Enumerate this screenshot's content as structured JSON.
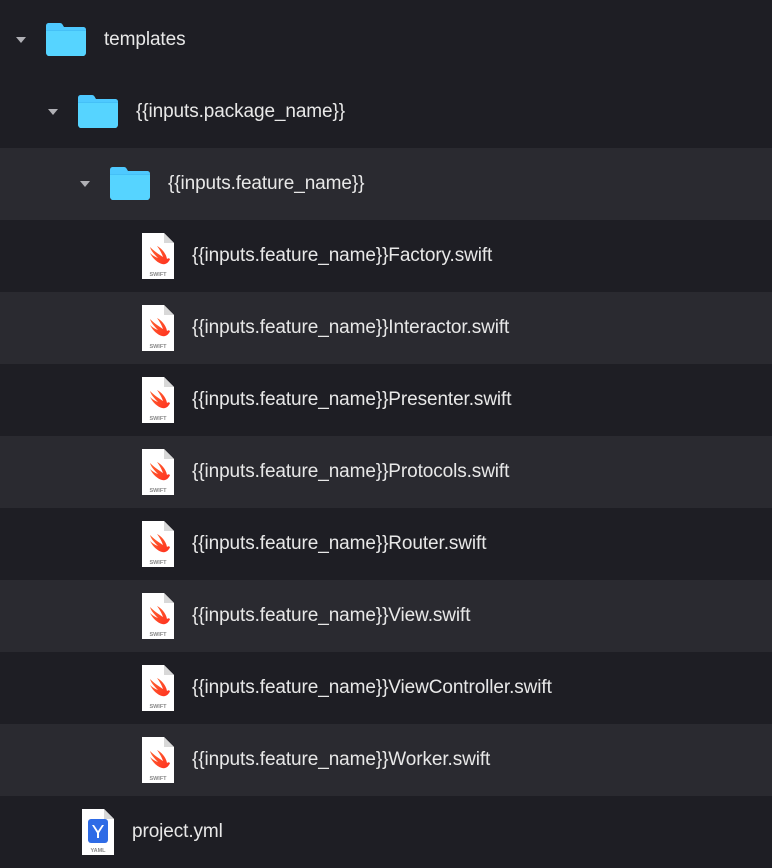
{
  "tree": {
    "root": {
      "label": "templates",
      "children": {
        "pkg": {
          "label": "{{inputs.package_name}}",
          "children": {
            "feat": {
              "label": "{{inputs.feature_name}}",
              "files": [
                "{{inputs.feature_name}}Factory.swift",
                "{{inputs.feature_name}}Interactor.swift",
                "{{inputs.feature_name}}Presenter.swift",
                "{{inputs.feature_name}}Protocols.swift",
                "{{inputs.feature_name}}Router.swift",
                "{{inputs.feature_name}}View.swift",
                "{{inputs.feature_name}}ViewController.swift",
                "{{inputs.feature_name}}Worker.swift"
              ]
            }
          }
        },
        "projectFile": {
          "label": "project.yml"
        }
      }
    }
  },
  "iconLabels": {
    "swift": "SWIFT",
    "yaml": "YAML"
  }
}
